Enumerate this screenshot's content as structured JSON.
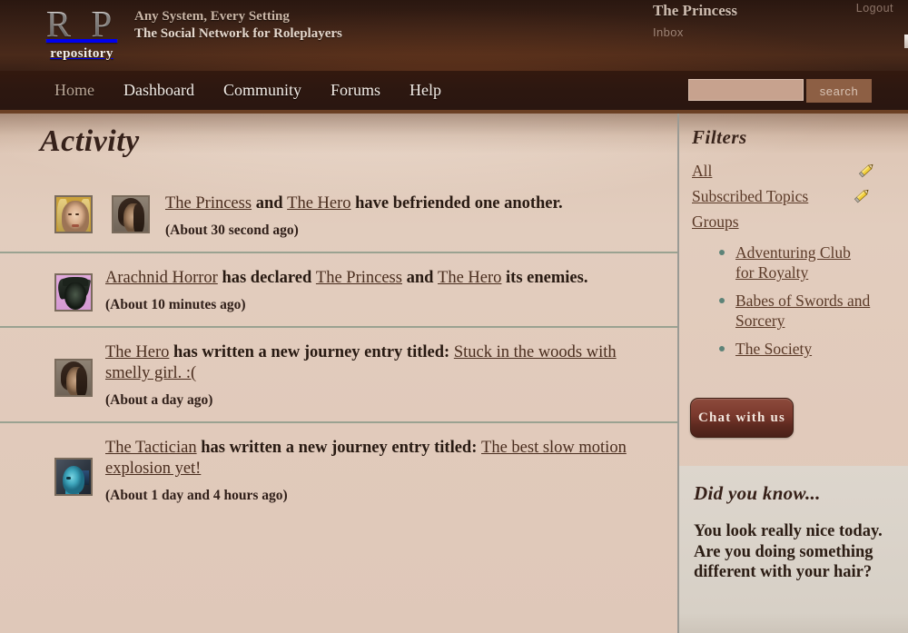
{
  "header": {
    "logo_main": "R P",
    "logo_sub": "repository",
    "tagline_line1": "Any System, Every Setting",
    "tagline_line2": "The Social Network for Roleplayers",
    "user_name": "The Princess",
    "inbox_label": "Inbox",
    "logout_label": "Logout"
  },
  "nav": {
    "items": [
      {
        "label": "Home",
        "muted": true
      },
      {
        "label": "Dashboard",
        "muted": false
      },
      {
        "label": "Community",
        "muted": false
      },
      {
        "label": "Forums",
        "muted": false
      },
      {
        "label": "Help",
        "muted": false
      }
    ],
    "search": {
      "value": "",
      "placeholder": "",
      "button_label": "search"
    }
  },
  "main": {
    "page_title": "Activity",
    "feed": [
      {
        "avatars": [
          "princess-avatar",
          "hero-avatar"
        ],
        "text_parts": [
          {
            "t": "The Princess",
            "link": true
          },
          {
            "t": " and ",
            "link": false
          },
          {
            "t": "The Hero",
            "link": true
          },
          {
            "t": " have befriended one another.",
            "link": false
          }
        ],
        "time": "(About 30 second ago)"
      },
      {
        "avatars": [
          "arachnid-horror-avatar"
        ],
        "text_parts": [
          {
            "t": "Arachnid Horror",
            "link": true
          },
          {
            "t": " has declared ",
            "link": false
          },
          {
            "t": "The Princess",
            "link": true
          },
          {
            "t": " and ",
            "link": false
          },
          {
            "t": "The Hero",
            "link": true
          },
          {
            "t": " its enemies.",
            "link": false
          }
        ],
        "time": "(About 10 minutes ago)"
      },
      {
        "avatars": [
          "hero-avatar"
        ],
        "text_parts": [
          {
            "t": "The Hero",
            "link": true
          },
          {
            "t": " has written a new journey entry titled: ",
            "link": false
          },
          {
            "t": "Stuck in the woods with smelly girl. :(",
            "link": true
          }
        ],
        "time": "(About a day ago)"
      },
      {
        "avatars": [
          "tactician-avatar"
        ],
        "text_parts": [
          {
            "t": "The Tactician",
            "link": true
          },
          {
            "t": " has written a new journey entry titled: ",
            "link": false
          },
          {
            "t": "The best slow motion explosion yet!",
            "link": true
          }
        ],
        "time": "(About 1 day and 4 hours ago)"
      }
    ]
  },
  "sidebar": {
    "title": "Filters",
    "filters": [
      {
        "label": "All",
        "has_pencil": true
      },
      {
        "label": "Subscribed Topics",
        "has_pencil": true
      },
      {
        "label": "Groups",
        "has_pencil": false
      }
    ],
    "groups": [
      "Adventuring Club for Royalty",
      "Babes of Swords and Sorcery",
      "The Society"
    ],
    "chat_button": "Chat with us",
    "did_you_know": {
      "title": "Did you know...",
      "text": "You look really nice today. Are you doing something different with your hair?"
    }
  },
  "colors": {
    "header_dark": "#2a1710",
    "nav_dark": "#2c1710",
    "nav_underline": "#6b4024",
    "page_bg": "#e1cabb",
    "link": "#5b3a28",
    "divider": "#9aa291",
    "bullet": "#5d8378",
    "search_field": "#c7a28e",
    "search_button": "#8d5f44",
    "chat_button": "#79382c",
    "dyk_bg": "#d7d0c6",
    "pencil": "#e8c233"
  }
}
